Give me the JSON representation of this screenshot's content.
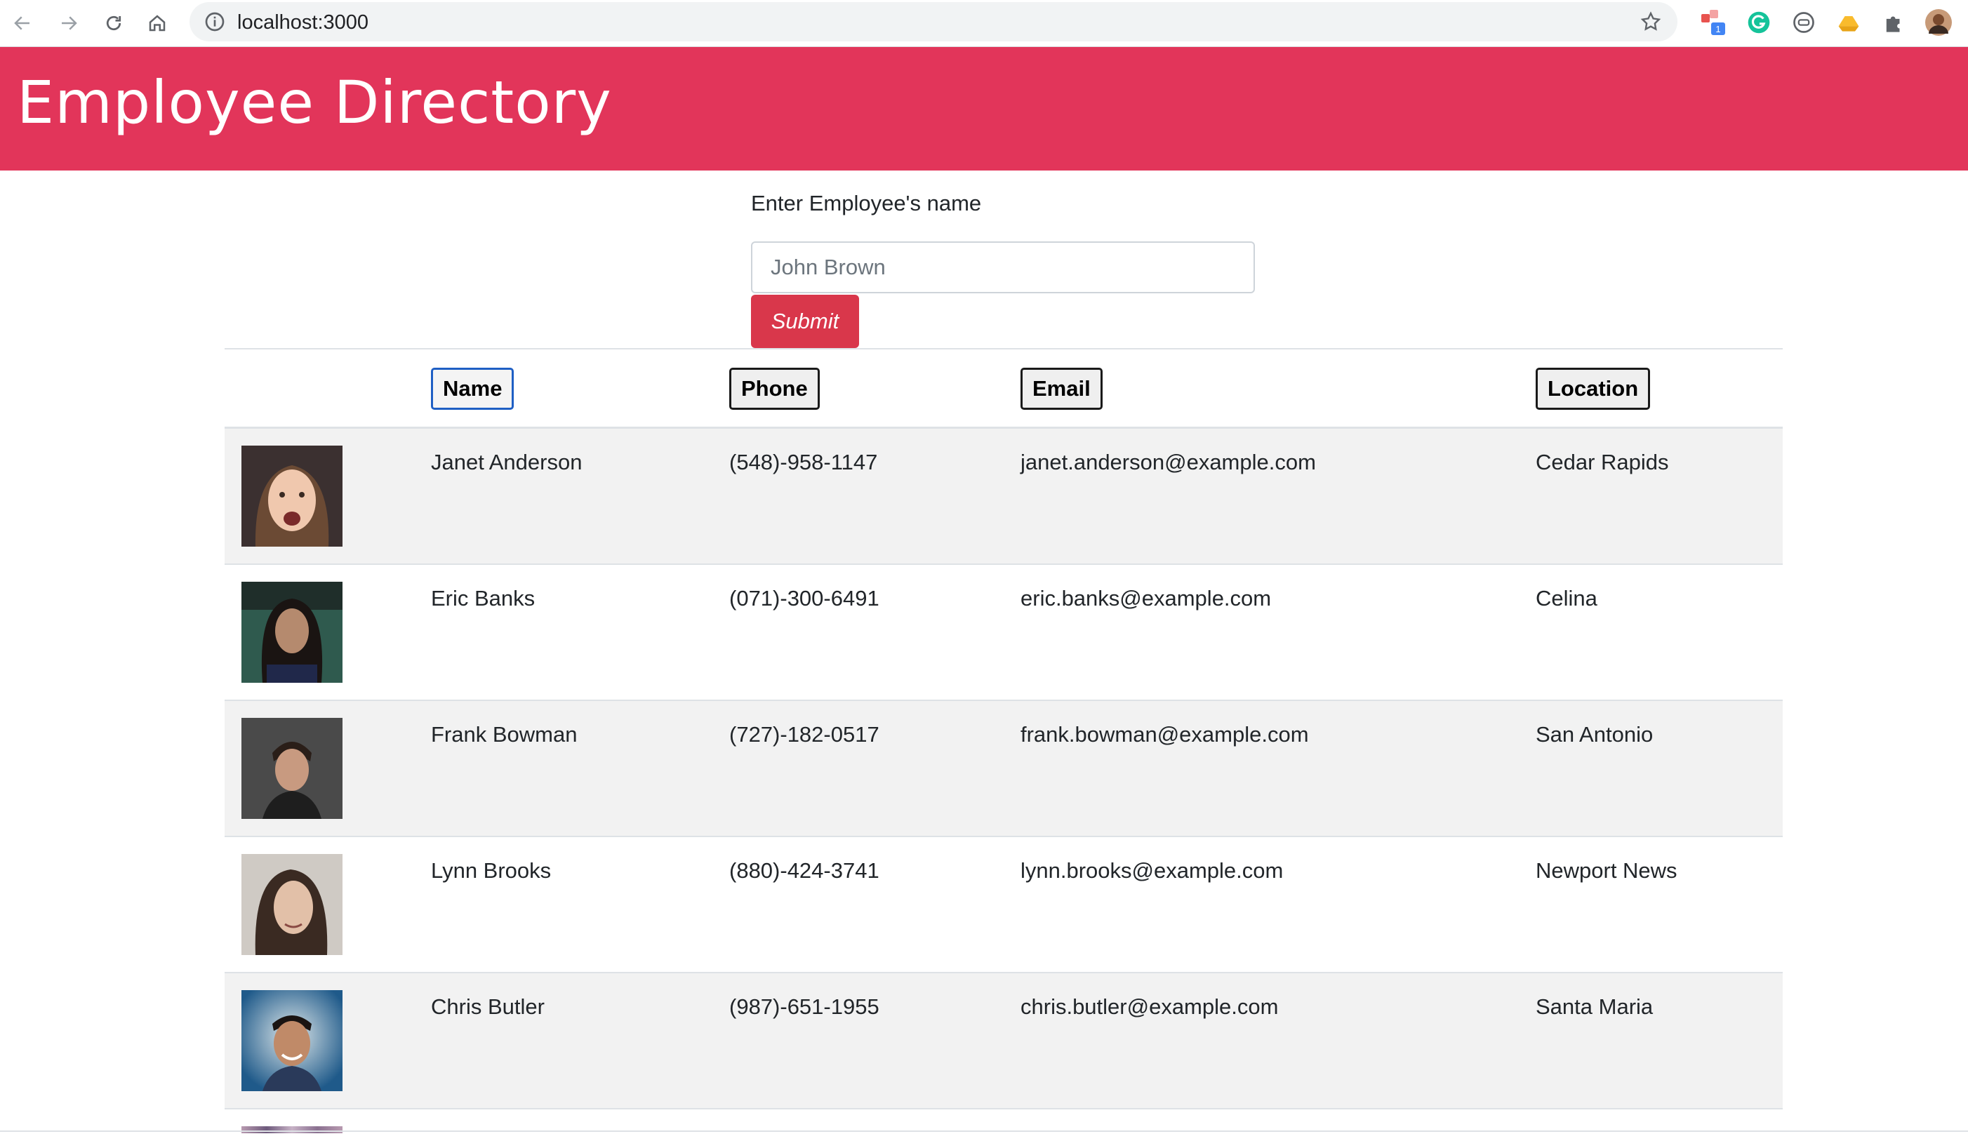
{
  "browser": {
    "url": "localhost:3000",
    "extension_badge": "1"
  },
  "header": {
    "title": "Employee Directory",
    "background_color": "#e2355a"
  },
  "search": {
    "label": "Enter Employee's name",
    "placeholder": "John Brown",
    "value": "",
    "submit_label": "Submit"
  },
  "table": {
    "columns": [
      "Name",
      "Phone",
      "Email",
      "Location"
    ],
    "rows": [
      {
        "name": "Janet Anderson",
        "phone": "(548)-958-1147",
        "email": "janet.anderson@example.com",
        "location": "Cedar Rapids"
      },
      {
        "name": "Eric Banks",
        "phone": "(071)-300-6491",
        "email": "eric.banks@example.com",
        "location": "Celina"
      },
      {
        "name": "Frank Bowman",
        "phone": "(727)-182-0517",
        "email": "frank.bowman@example.com",
        "location": "San Antonio"
      },
      {
        "name": "Lynn Brooks",
        "phone": "(880)-424-3741",
        "email": "lynn.brooks@example.com",
        "location": "Newport News"
      },
      {
        "name": "Chris Butler",
        "phone": "(987)-651-1955",
        "email": "chris.butler@example.com",
        "location": "Santa Maria"
      }
    ]
  }
}
